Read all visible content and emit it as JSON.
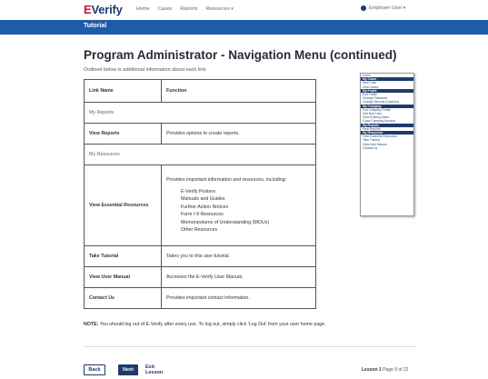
{
  "topnav": {
    "logo_prefix": "E",
    "logo_rest": "Verify",
    "links": [
      "Home",
      "Cases",
      "Reports",
      "Resources"
    ],
    "user_label": "Employer User"
  },
  "tutorial_bar": {
    "label": "Tutorial"
  },
  "page": {
    "title": "Program Administrator - Navigation Menu (continued)",
    "subtitle": "Outlined below is additional information about each link:"
  },
  "table": {
    "headers": {
      "link_name": "Link Name",
      "function": "Function"
    },
    "rows": {
      "my_reports": "My Reports",
      "view_reports": {
        "link": "View Reports",
        "function": "Provides options to create reports."
      },
      "my_resources": "My Resources",
      "view_essential": {
        "link": "View Essential Resources",
        "intro": "Provides important information and resources, including:",
        "items": [
          "E-Verify Posters",
          "Manuals and Guides",
          "Further Action Notices",
          "Form I-9 Resources",
          "Memorandums of Understanding (MOUs)",
          "Other Resources"
        ]
      },
      "take_tutorial": {
        "link": "Take Tutorial",
        "function": "Takes you to this user tutorial."
      },
      "view_manual": {
        "link": "View User Manual",
        "function": "Accesses the E-Verify User Manual."
      },
      "contact_us": {
        "link": "Contact Us",
        "function": "Provides important contact information."
      }
    }
  },
  "note": {
    "label": "NOTE:",
    "text": "You should log out of E-Verify after every use. To log out, simply click 'Log Out' from your user home page."
  },
  "side_menu": {
    "top_item": "Home",
    "sections": [
      {
        "title": "My Cases",
        "items": [
          "New Case",
          "View Cases"
        ]
      },
      {
        "title": "My Profile",
        "items": [
          "Edit Profile",
          "Change Password",
          "Change Security Questions"
        ]
      },
      {
        "title": "My Company",
        "items": [
          "Edit Company Profile",
          "Add New User",
          "View Existing Users",
          "Close Company Account"
        ]
      },
      {
        "title": "My Reports",
        "items": [
          "View Reports"
        ]
      },
      {
        "title": "My Resources",
        "items": [
          "View Essential Resources",
          "Take Tutorial",
          "View User Manual",
          "Contact Us"
        ]
      }
    ]
  },
  "footer": {
    "back_label": "Back",
    "next_label": "Next",
    "exit_label": "Exit Lesson",
    "lesson_label": "Lesson 1",
    "page_label": "Page 9 of 22"
  }
}
